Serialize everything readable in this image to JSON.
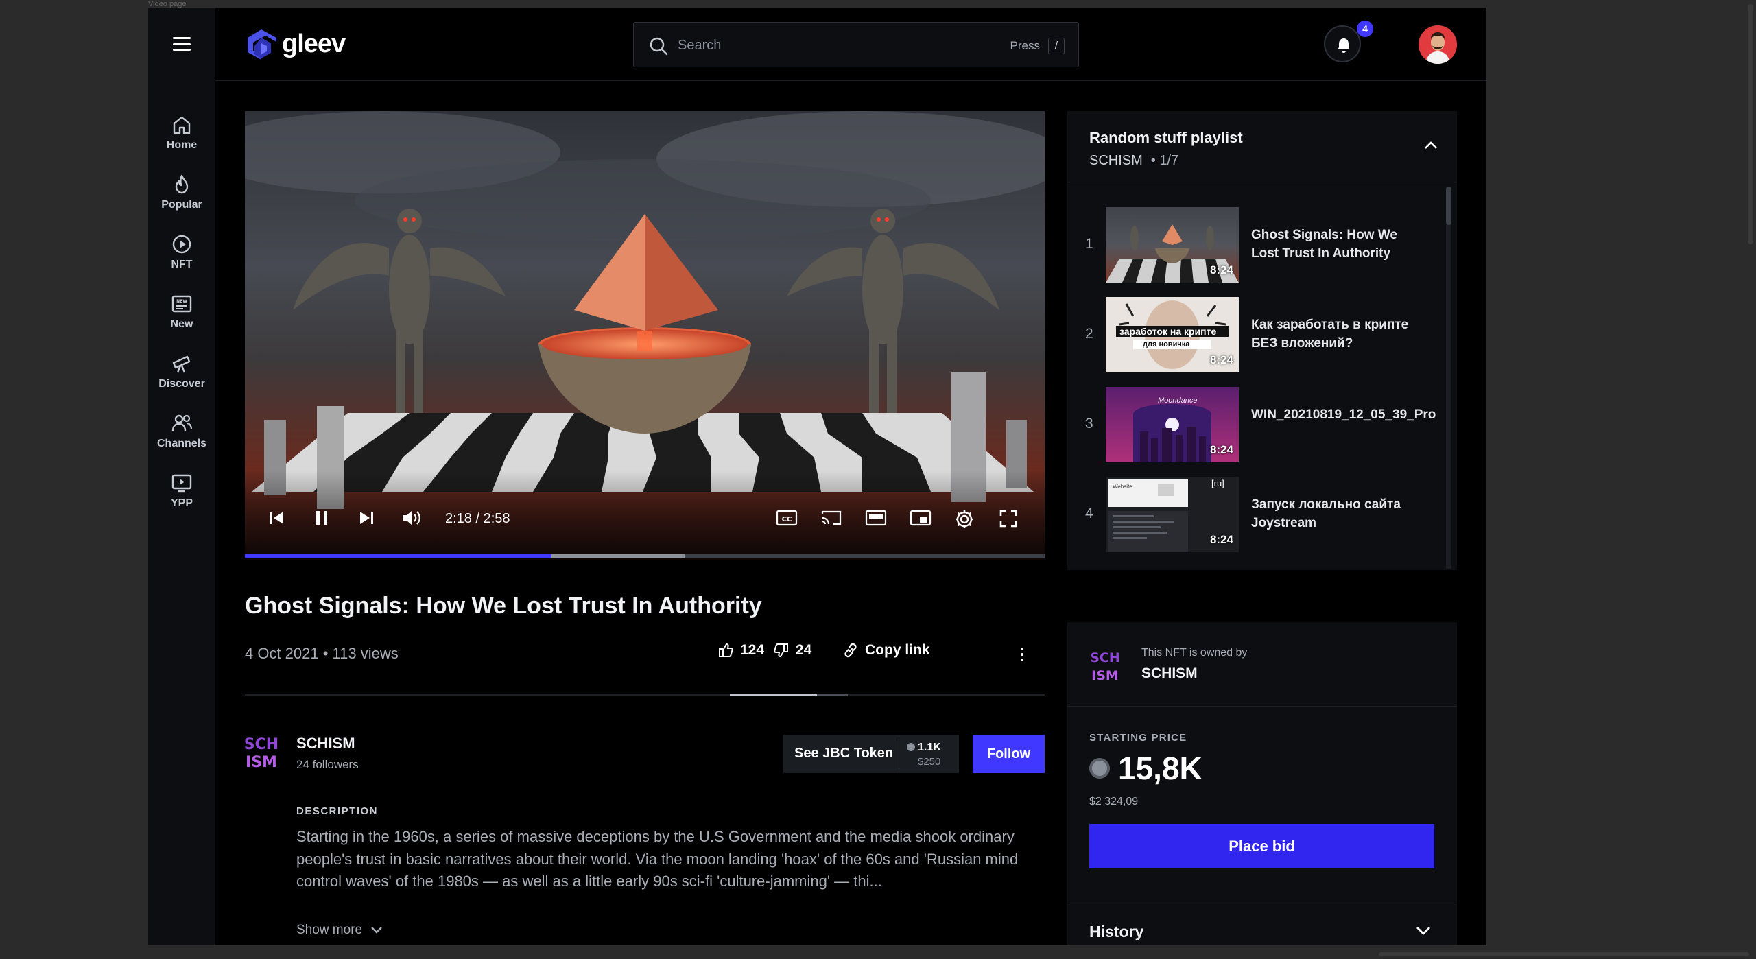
{
  "frame_label": "Video page",
  "nav": {
    "items": [
      {
        "label": "Home",
        "icon": "home-icon"
      },
      {
        "label": "Popular",
        "icon": "flame-icon"
      },
      {
        "label": "NFT",
        "icon": "play-circle-icon"
      },
      {
        "label": "New",
        "icon": "new-badge-icon"
      },
      {
        "label": "Discover",
        "icon": "telescope-icon"
      },
      {
        "label": "Channels",
        "icon": "people-icon"
      },
      {
        "label": "YPP",
        "icon": "ypp-icon"
      }
    ]
  },
  "header": {
    "logo_text": "gleev",
    "search_placeholder": "Search",
    "press_label": "Press",
    "shortcut_key": "/",
    "notification_count": "4"
  },
  "player": {
    "time": "2:18 / 2:58",
    "played_fraction": 0.383,
    "buffered_fraction": 0.55,
    "accent": "#4038ff"
  },
  "video": {
    "title": "Ghost Signals: How We Lost Trust In Authority",
    "meta": "4 Oct 2021 • 113 views",
    "likes": "124",
    "dislikes": "24",
    "copy_link": "Copy link"
  },
  "channel": {
    "name": "SCHISM",
    "followers": "24 followers",
    "jbc_label": "See JBC Token",
    "jbc_value": "1.1K",
    "jbc_usd": "$250",
    "follow_label": "Follow"
  },
  "description": {
    "heading": "DESCRIPTION",
    "text": "Starting in the 1960s, a series of massive deceptions by the U.S Government and the media shook ordinary people's trust in basic narratives about their world. Via the moon landing 'hoax' of the 60s and 'Russian mind control waves' of the 1980s — as well as a little early 90s sci-fi 'culture-jamming' — thi...",
    "show_more": "Show more"
  },
  "playlist": {
    "title": "Random stuff playlist",
    "channel": "SCHISM",
    "position": "1/7",
    "items": [
      {
        "num": "1",
        "title": "Ghost Signals: How We Lost Trust In Authority",
        "duration": "8:24"
      },
      {
        "num": "2",
        "title": "Как заработать в крипте БЕЗ вложений?",
        "duration": "8:24",
        "overlay": "заработок на крипте",
        "overlay2": "для новичка"
      },
      {
        "num": "3",
        "title": "WIN_20210819_12_05_39_Pro",
        "duration": "8:24",
        "overlay": "Moondance"
      },
      {
        "num": "4",
        "title": "Запуск локально сайта Joystream",
        "duration": "8:24",
        "overlay": "[ru]",
        "overlay2": "Website"
      }
    ]
  },
  "nft": {
    "owned_by": "This NFT is owned by",
    "owner": "SCHISM",
    "starting_price_label": "STARTING PRICE",
    "price": "15,8K",
    "usd": "$2 324,09",
    "bid_label": "Place bid",
    "history_label": "History"
  }
}
